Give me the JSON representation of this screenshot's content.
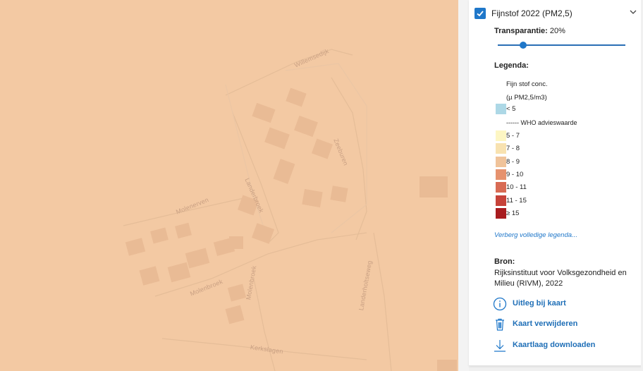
{
  "map": {
    "overlay_color": "#f3c9a3",
    "street_labels": [
      "Willemsedijk",
      "Zeeburen",
      "Landerbroek",
      "Molenerven",
      "Molenbroek",
      "Molenbroek",
      "Landerholtseweg",
      "Kerkslagen"
    ]
  },
  "layer": {
    "title": "Fijnstof 2022 (PM2,5)",
    "checked": true,
    "transparency_label": "Transparantie:",
    "transparency_value": "20%",
    "transparency_fraction": 0.2
  },
  "legend": {
    "heading": "Legenda:",
    "subtitle_line1": "Fijn stof conc.",
    "subtitle_line2": "(µ PM2,5/m3)",
    "who_line": "------ WHO advieswaarde",
    "items": [
      {
        "label": "< 5",
        "color": "#add8e6"
      },
      {
        "label": "5 - 7",
        "color": "#fdf6c3"
      },
      {
        "label": "7 - 8",
        "color": "#f8e2b0"
      },
      {
        "label": "8 - 9",
        "color": "#f0c39a"
      },
      {
        "label": "9 - 10",
        "color": "#e6926e"
      },
      {
        "label": "10 - 11",
        "color": "#d86b54"
      },
      {
        "label": "11 - 15",
        "color": "#c7433a"
      },
      {
        "label": "≥ 15",
        "color": "#a81c1f"
      }
    ],
    "toggle_label": "Verberg volledige legenda..."
  },
  "source": {
    "heading": "Bron:",
    "text": "Rijksinstituut voor Volksgezondheid en Milieu (RIVM), 2022"
  },
  "actions": {
    "explain": {
      "label": "Uitleg bij kaart",
      "icon": "info-circle-icon"
    },
    "remove": {
      "label": "Kaart verwijderen",
      "icon": "trash-icon"
    },
    "download": {
      "label": "Kaartlaag downloaden",
      "icon": "download-icon"
    }
  },
  "colors": {
    "accent": "#1f77c9",
    "link": "#1f6fb7"
  }
}
